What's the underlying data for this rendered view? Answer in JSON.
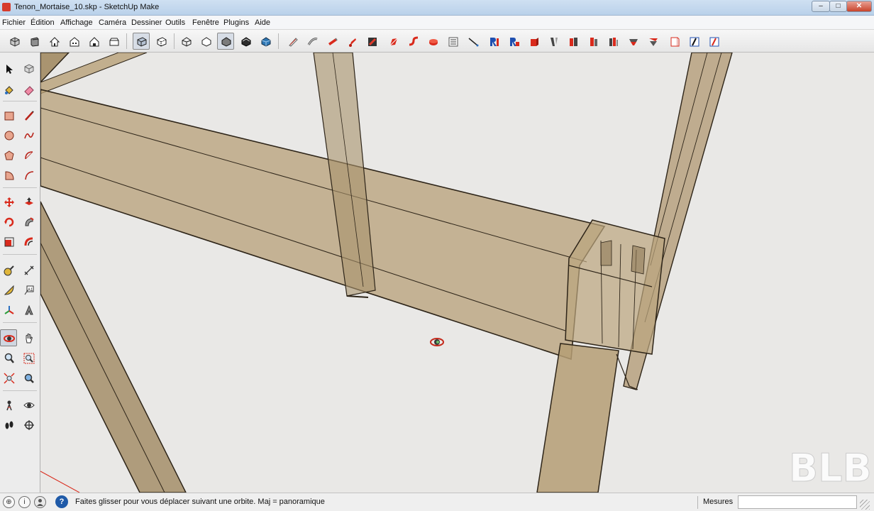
{
  "window": {
    "title": "Tenon_Mortaise_10.skp - SketchUp Make",
    "minimize_glyph": "–",
    "maximize_glyph": "□",
    "close_glyph": "✕"
  },
  "menu": [
    "Fichier",
    "Édition",
    "Affichage",
    "Caméra",
    "Dessiner",
    "Outils",
    "Fenêtre",
    "Plugins",
    "Aide"
  ],
  "toolbar": {
    "icons": [
      "camera-views-icon",
      "iso-view-icon",
      "top-view-icon",
      "front-view-icon",
      "right-view-icon",
      "back-view-icon",
      "xray-style-icon",
      "back-edges-style-icon",
      "wireframe-style-icon",
      "hidden-line-style-icon",
      "shaded-style-icon",
      "shaded-textures-style-icon",
      "monochrome-style-icon",
      "plugin-tool-1-icon",
      "plugin-tool-2-icon",
      "plugin-tool-3-icon",
      "plugin-tool-4-icon",
      "plugin-tool-5-icon",
      "plugin-tool-6-icon",
      "plugin-tool-7-icon",
      "plugin-tool-8-icon",
      "plugin-list-icon",
      "plugin-line-icon",
      "plugin-tool-9-icon",
      "plugin-tool-10-icon",
      "plugin-tool-11-icon",
      "plugin-tool-12-icon",
      "plugin-tool-13-icon",
      "plugin-tool-14-icon",
      "plugin-tool-15-icon",
      "plugin-tool-16-icon",
      "plugin-tool-17-icon",
      "plugin-tool-18-icon",
      "plugin-tool-19-icon",
      "plugin-tool-20-icon"
    ],
    "active": [
      "xray-style-icon",
      "wireframe-style-icon"
    ]
  },
  "left_tools": {
    "icons": [
      "select-icon",
      "make-component-icon",
      "paint-bucket-icon",
      "eraser-icon",
      "rectangle-icon",
      "line-icon",
      "circle-icon",
      "freehand-icon",
      "polygon-icon",
      "arc-icon",
      "pie-icon",
      "arc-2pt-icon",
      "move-icon",
      "push-pull-icon",
      "rotate-icon",
      "follow-me-icon",
      "scale-icon",
      "offset-icon",
      "tape-measure-icon",
      "dimension-icon",
      "protractor-icon",
      "text-icon",
      "axes-icon",
      "3d-text-icon",
      "orbit-icon",
      "pan-icon",
      "zoom-icon",
      "zoom-window-icon",
      "zoom-extents-icon",
      "previous-view-icon",
      "position-camera-icon",
      "look-around-icon",
      "walk-icon",
      "section-plane-icon"
    ],
    "active": "orbit-icon"
  },
  "viewport": {
    "background": "#e9e8e6",
    "wood_color": "#b59d74",
    "edge_color": "#2d2418",
    "watermark": "BLB"
  },
  "status": {
    "instruction": "Faites glisser pour vous déplacer suivant une orbite.  Maj = panoramique",
    "measure_label": "Mesures",
    "measure_value": "",
    "help_glyph": "?",
    "info_glyph": "i",
    "geo_glyph": "⊕"
  }
}
